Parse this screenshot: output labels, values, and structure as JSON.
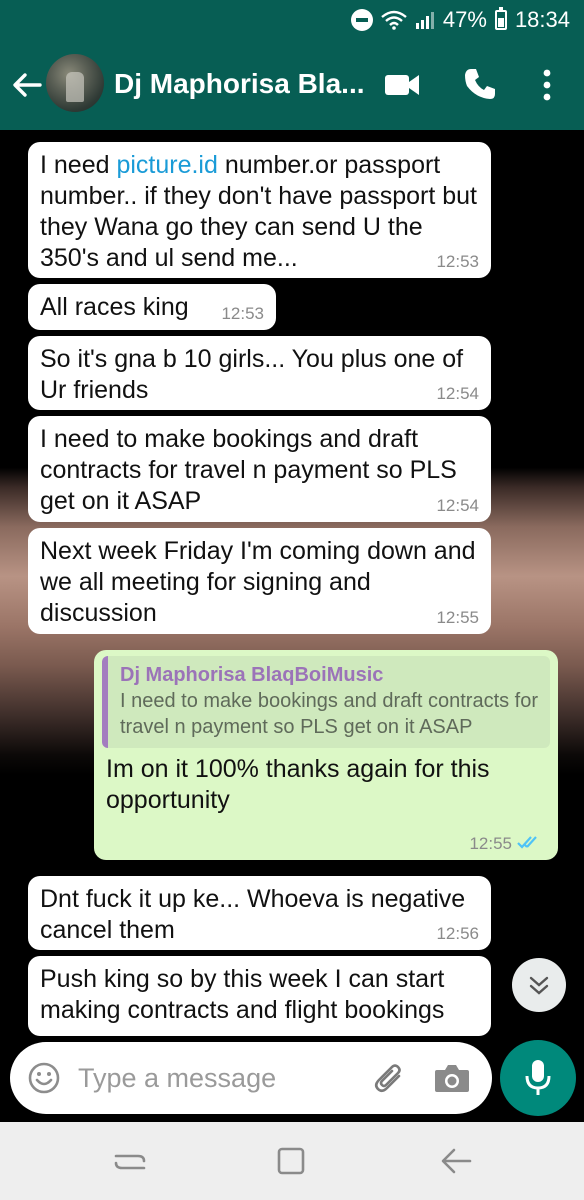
{
  "status_bar": {
    "battery": "47%",
    "time": "18:34"
  },
  "header": {
    "contact_name": "Dj Maphorisa Bla..."
  },
  "messages": [
    {
      "dir": "in",
      "text_prefix": "I need ",
      "link": "picture.id",
      "text_suffix": " number.or passport number.. if they don't have passport but they Wana go they can send U the 350's and ul send me...",
      "time": "12:53"
    },
    {
      "dir": "in",
      "text": "All races king",
      "time": "12:53"
    },
    {
      "dir": "in",
      "text": "So it's gna b 10 girls... You plus one of Ur friends",
      "time": "12:54"
    },
    {
      "dir": "in",
      "text": "I need to make bookings and draft contracts for travel n payment so PLS get on it ASAP",
      "time": "12:54"
    },
    {
      "dir": "in",
      "text": "Next week Friday I'm coming down and we all meeting for signing and discussion",
      "time": "12:55"
    },
    {
      "dir": "out",
      "quote_name": "Dj Maphorisa BlaqBoiMusic",
      "quote_text": "I need to make bookings and draft contracts for travel n payment so PLS get on it ASAP",
      "text": "Im on it 100% thanks again for this opportunity",
      "time": "12:55",
      "status": "read"
    },
    {
      "dir": "in",
      "text": "Dnt fuck it up ke... Whoeva is negative cancel them",
      "time": "12:56"
    },
    {
      "dir": "in",
      "text": "Push king so by this week I can start making contracts and flight bookings",
      "time": ""
    }
  ],
  "input": {
    "placeholder": "Type a message"
  },
  "colors": {
    "header": "#075E54",
    "outgoing_bubble": "#DCF8C6",
    "incoming_bubble": "#FFFFFF",
    "mic_button": "#00897B",
    "read_ticks": "#4FC3F7"
  }
}
